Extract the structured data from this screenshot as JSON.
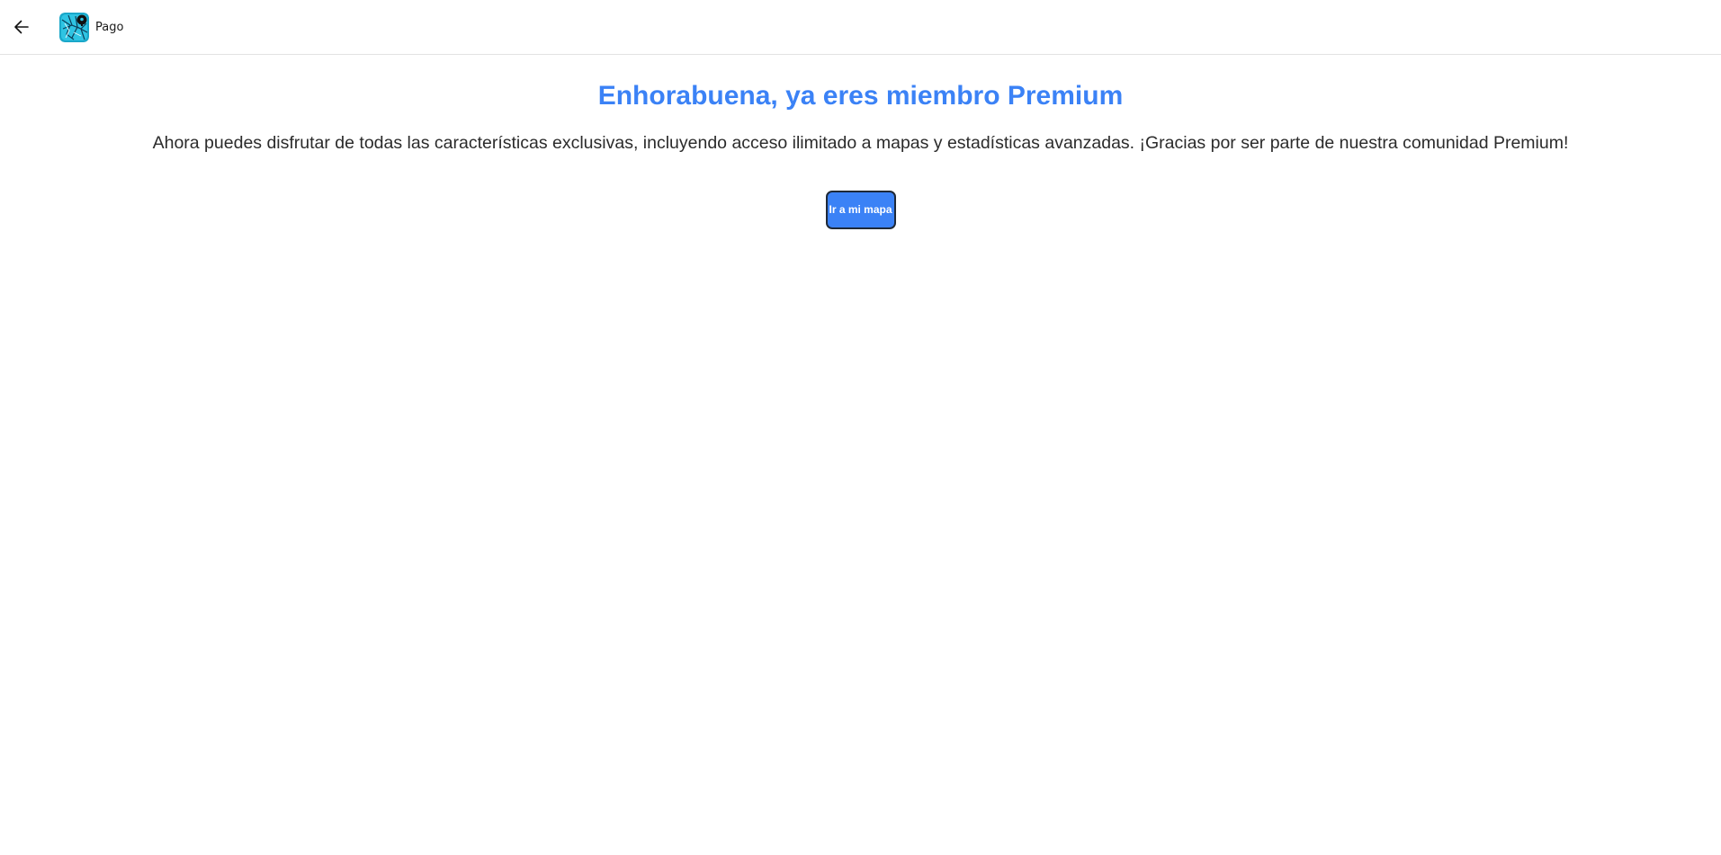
{
  "titlebar": {
    "back_icon": "arrow-left-icon",
    "app_icon": "app-logo-icon",
    "title": "Pago"
  },
  "main": {
    "headline": "Enhorabuena, ya eres miembro Premium",
    "message": "Ahora puedes disfrutar de todas las características exclusivas, incluyendo acceso ilimitado a mapas y estadísticas avanzadas. ¡Gracias por ser parte de nuestra comunidad Premium!",
    "button_label": "Ir a mi mapa"
  },
  "colors": {
    "accent": "#3b82f6",
    "text": "#2b2b2b",
    "button_border": "#1f2937"
  }
}
